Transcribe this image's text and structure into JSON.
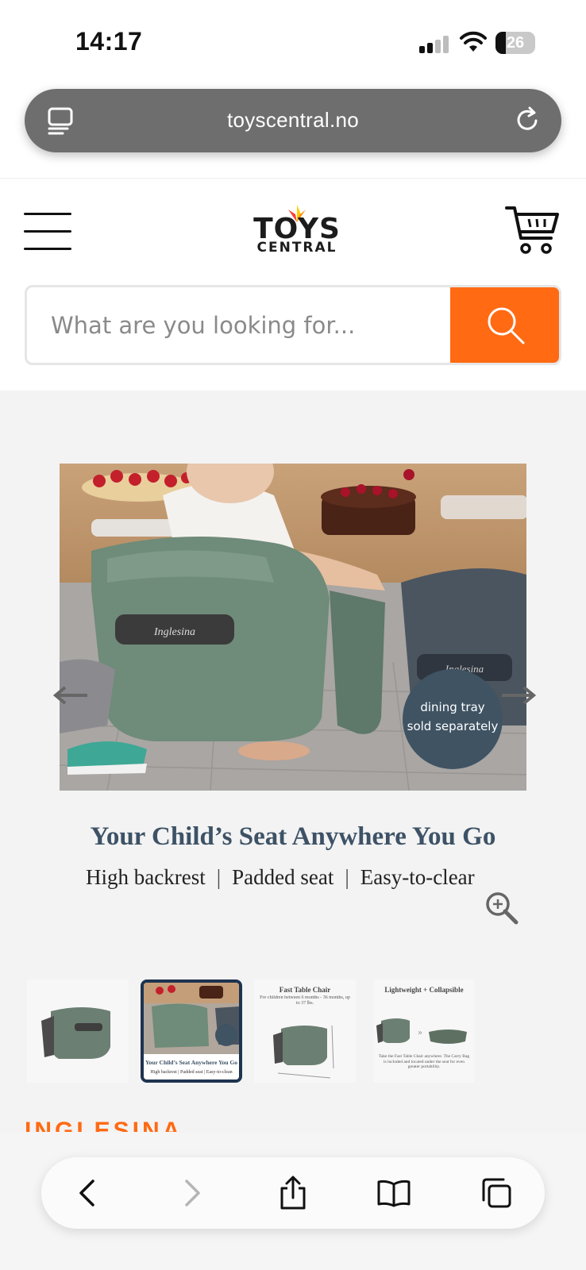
{
  "status_bar": {
    "time": "14:17",
    "battery_percent": "26",
    "battery_level": 0.26
  },
  "browser": {
    "url": "toyscentral.no"
  },
  "header": {
    "logo_top": "TOYS",
    "logo_bottom": "CENTRAL"
  },
  "search": {
    "placeholder": "What are you looking for..."
  },
  "product": {
    "image_badge_line1": "dining tray",
    "image_badge_line2": "sold separately",
    "image_brand_label": "Inglesina",
    "headline": "Your Child’s Seat Anywhere You Go",
    "features": [
      "High backrest",
      "Padded seat",
      "Easy-to-clear"
    ],
    "thumbnails": [
      {
        "caption": ""
      },
      {
        "caption": "Your Child’s Seat Anywhere You Go",
        "subcaption": "High backrest | Padded seat | Easy-to-clean"
      },
      {
        "caption": "Fast Table Chair",
        "subcaption": "For children between 6 months - 36 months, up to 37 lbs."
      },
      {
        "caption": "Lightweight + Collapsible",
        "subcaption": "Take the Fast Table Chair anywhere. The Carry Bag is included and located under the seat for even greater portability."
      }
    ],
    "brand_peek": "INGLESINA"
  },
  "colors": {
    "accent": "#ff6a13",
    "headline": "#3d5266",
    "active_thumb_border": "#1e3350"
  }
}
